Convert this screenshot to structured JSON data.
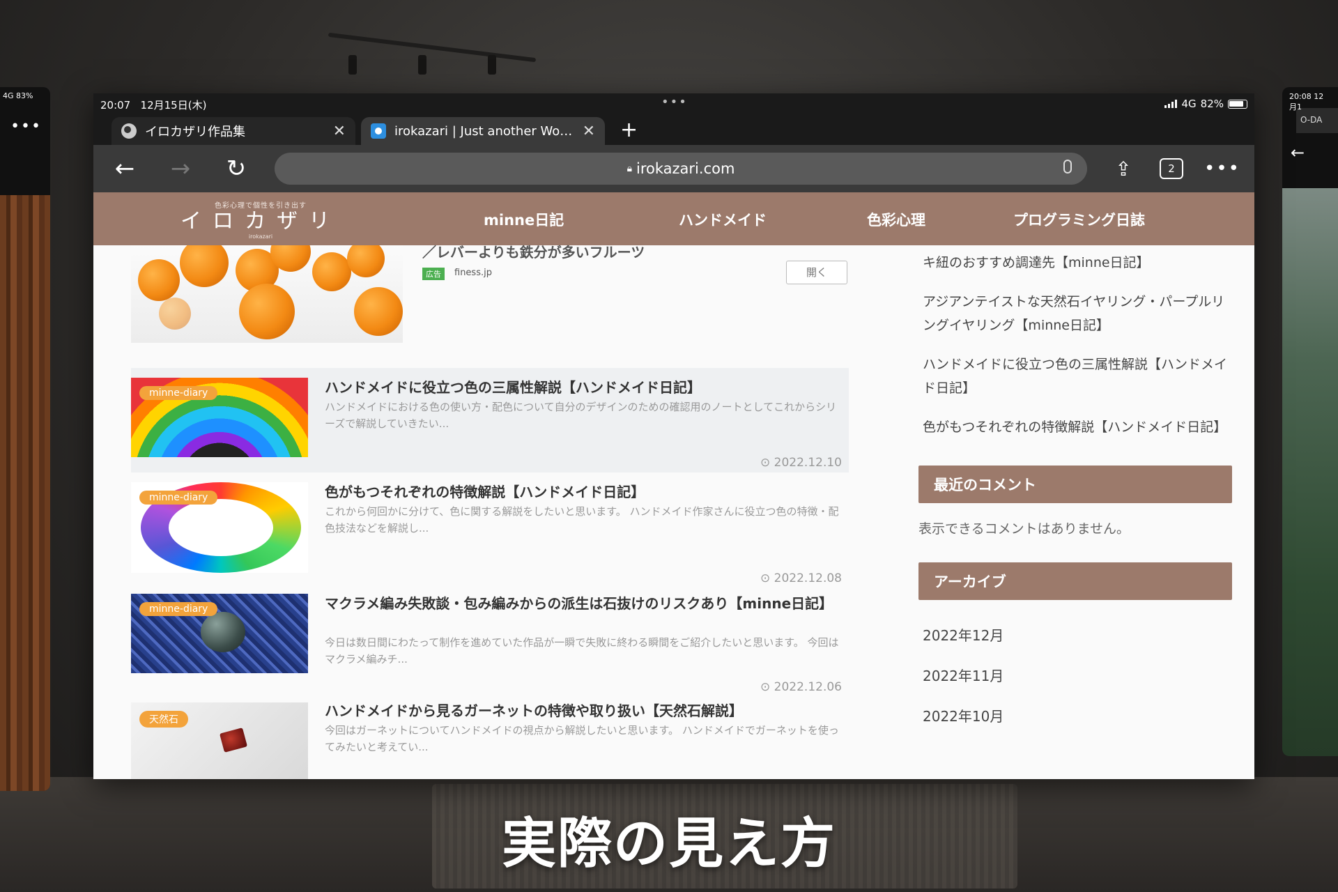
{
  "left_window": {
    "status": "4G 83%",
    "more": "•••"
  },
  "right_window": {
    "status": "20:08  12月1",
    "tab_stub": "O-DA",
    "back": "←"
  },
  "status_bar": {
    "time": "20:07",
    "date": "12月15日(木)",
    "dots": "•••",
    "network": "4G",
    "battery": "82%"
  },
  "tabs": [
    {
      "title": "イロカザリ作品集",
      "close": "✕",
      "active": false
    },
    {
      "title": "irokazari | Just another WordPress site",
      "close": "✕",
      "active": true
    }
  ],
  "new_tab": "+",
  "toolbar": {
    "back": "←",
    "forward": "→",
    "reload": "↻",
    "url": "irokazari.com",
    "tab_count": "2",
    "share": "⇪",
    "more": "•••"
  },
  "site": {
    "logo": {
      "tagline": "色彩心理で個性を引き出す",
      "name": "イロカザリ",
      "sub": "irokazari"
    },
    "nav": [
      "minne日記",
      "ハンドメイド",
      "色彩心理",
      "プログラミング日誌"
    ],
    "ad": {
      "title": "／レバーよりも鉄分が多いフルーツ",
      "badge": "広告",
      "domain": "finess.jp",
      "button": "開く"
    },
    "posts": [
      {
        "category": "minne-diary",
        "title": "ハンドメイドに役立つ色の三属性解説【ハンドメイド日記】",
        "excerpt": "ハンドメイドにおける色の使い方・配色について自分のデザインのための確認用のノートとしてこれからシリーズで解説していきたい...",
        "date": "⊙ 2022.12.10"
      },
      {
        "category": "minne-diary",
        "title": "色がもつそれぞれの特徴解説【ハンドメイド日記】",
        "excerpt": "これから何回かに分けて、色に関する解説をしたいと思います。 ハンドメイド作家さんに役立つ色の特徴・配色技法などを解説し...",
        "date": "⊙ 2022.12.08"
      },
      {
        "category": "minne-diary",
        "title": "マクラメ編み失敗談・包み編みからの派生は石抜けのリスクあり【minne日記】",
        "excerpt": "今日は数日間にわたって制作を進めていた作品が一瞬で失敗に終わる瞬間をご紹介したいと思います。 今回はマクラメ編みチ...",
        "date": "⊙ 2022.12.06"
      },
      {
        "category": "天然石",
        "title": "ハンドメイドから見るガーネットの特徴や取り扱い【天然石解説】",
        "excerpt": "今回はガーネットについてハンドメイドの視点から解説したいと思います。 ハンドメイドでガーネットを使ってみたいと考えてい...",
        "date": ""
      }
    ],
    "sidebar": {
      "recent_posts": [
        "キ紐のおすすめ調達先【minne日記】",
        "アジアンテイストな天然石イヤリング・パープルリングイヤリング【minne日記】",
        "ハンドメイドに役立つ色の三属性解説【ハンドメイド日記】",
        "色がもつそれぞれの特徴解説【ハンドメイド日記】"
      ],
      "comments_heading": "最近のコメント",
      "comments_empty": "表示できるコメントはありません。",
      "archive_heading": "アーカイブ",
      "archives": [
        "2022年12月",
        "2022年11月",
        "2022年10月"
      ]
    },
    "to_top": "︽"
  },
  "caption": "実際の見え方",
  "colors": {
    "brand": "#9c7a6b",
    "category_badge": "#f3a33b",
    "chrome_dark": "#3a3a3a"
  }
}
